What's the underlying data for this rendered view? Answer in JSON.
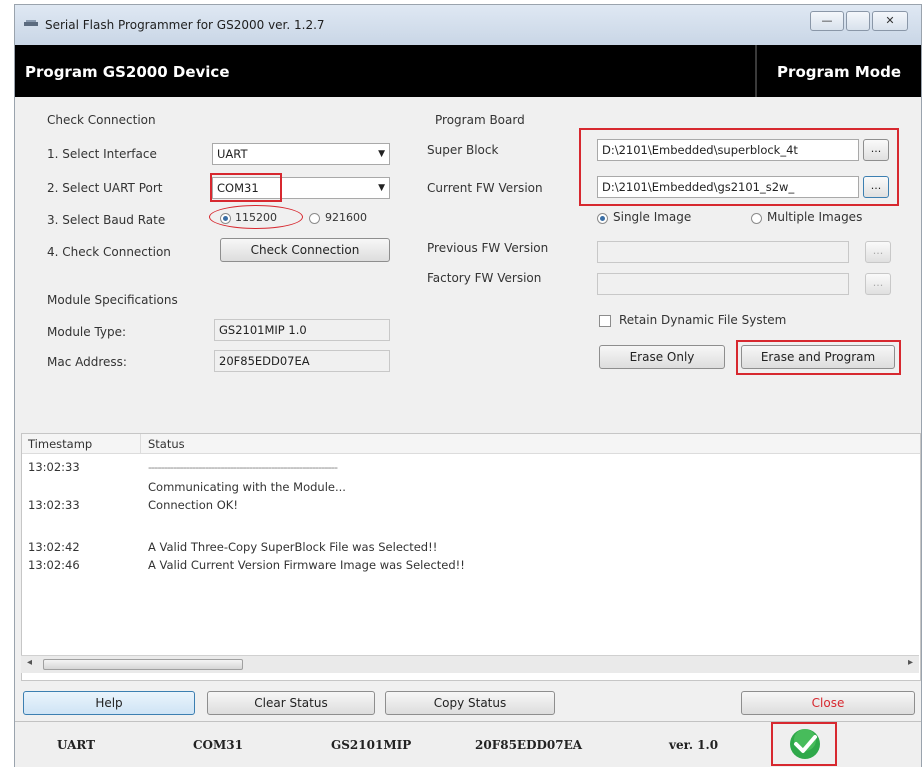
{
  "window": {
    "title": "Serial Flash Programmer for GS2000  ver. 1.2.7",
    "minimize_label": "—",
    "close_label": "✕"
  },
  "header": {
    "title": "Program GS2000 Device",
    "mode": "Program Mode"
  },
  "check_connection": {
    "section_title": "Check Connection",
    "interface_label": "1. Select Interface",
    "interface_value": "UART",
    "port_label": "2. Select UART Port",
    "port_value": "COM31",
    "baud_label": "3. Select Baud Rate",
    "baud_options": [
      "115200",
      "921600"
    ],
    "check_label": "4. Check Connection",
    "check_button": "Check Connection"
  },
  "module_specs": {
    "section_title": "Module Specifications",
    "type_label": "Module Type:",
    "type_value": "GS2101MIP 1.0",
    "mac_label": "Mac Address:",
    "mac_value": "20F85EDD07EA"
  },
  "program_board": {
    "section_title": "Program Board",
    "super_block_label": "Super Block",
    "super_block_value": "D:\\2101\\Embedded\\superblock_4t",
    "current_fw_label": "Current FW Version",
    "current_fw_value": "D:\\2101\\Embedded\\gs2101_s2w_",
    "browse_label": "...",
    "single_image": "Single Image",
    "multiple_images": "Multiple Images",
    "previous_fw_label": "Previous FW Version",
    "factory_fw_label": "Factory FW Version",
    "retain_label": "Retain Dynamic File System",
    "erase_only": "Erase Only",
    "erase_program": "Erase and Program"
  },
  "status": {
    "headers": [
      "Timestamp",
      "Status"
    ],
    "rows": [
      {
        "ts": "13:02:33",
        "msg": "------------------------------------------------------------"
      },
      {
        "ts": "",
        "msg": "Communicating with the Module..."
      },
      {
        "ts": "13:02:33",
        "msg": "Connection OK!"
      },
      {
        "ts": "13:02:42",
        "msg": "A Valid Three-Copy SuperBlock File was Selected!!"
      },
      {
        "ts": "13:02:46",
        "msg": "A Valid Current Version Firmware Image was Selected!!"
      }
    ]
  },
  "buttons": {
    "help": "Help",
    "clear_status": "Clear Status",
    "copy_status": "Copy Status",
    "close": "Close"
  },
  "statusbar": {
    "interface": "UART",
    "port": "COM31",
    "module": "GS2101MIP",
    "mac": "20F85EDD07EA",
    "version": "ver. 1.0"
  },
  "colors": {
    "highlight": "#d7282f",
    "header_bg": "#000000",
    "ok_green": "#2fa84a"
  }
}
